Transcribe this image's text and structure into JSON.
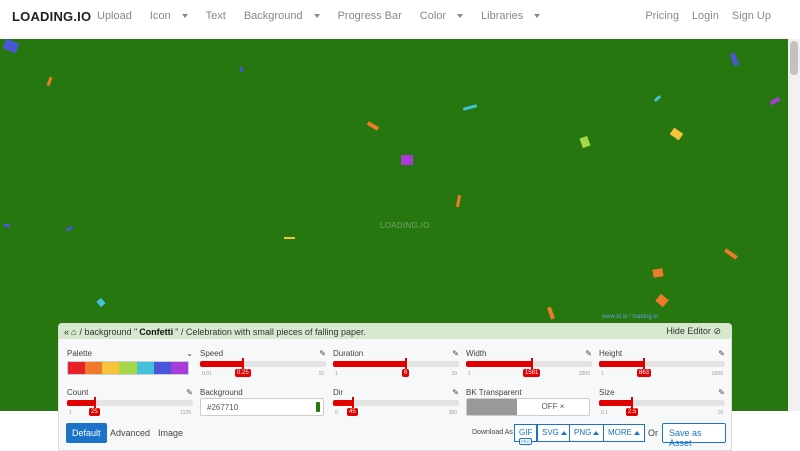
{
  "nav": {
    "brand": "LOADING.IO",
    "left_items": [
      {
        "label": "Upload",
        "dropdown": false
      },
      {
        "label": "Icon",
        "dropdown": true
      },
      {
        "label": "Text",
        "dropdown": false
      },
      {
        "label": "Background",
        "dropdown": true
      },
      {
        "label": "Progress Bar",
        "dropdown": false
      },
      {
        "label": "Color",
        "dropdown": true
      },
      {
        "label": "Libraries",
        "dropdown": true
      }
    ],
    "right_items": [
      "Pricing",
      "Login",
      "Sign Up"
    ]
  },
  "stage": {
    "background_color": "#267710",
    "watermark": "LOADING.IO",
    "credit": "www.ld.io / loading.io"
  },
  "editor": {
    "breadcrumb_home_icon": "home-icon",
    "breadcrumb_prefix": "/ background \"",
    "breadcrumb_name": "Confetti",
    "breadcrumb_suffix": "\" / Celebration with small pieces of falling paper.",
    "hide_label": "Hide Editor",
    "controls": {
      "palette": {
        "label": "Palette",
        "colors": [
          "#e8202a",
          "#f07a2a",
          "#f6c33a",
          "#a6d94a",
          "#44c2d8",
          "#4a56d8",
          "#a93cd8"
        ]
      },
      "speed": {
        "label": "Speed",
        "min": "0.01",
        "max": "10",
        "value": "0.25",
        "fraction": 0.34
      },
      "duration": {
        "label": "Duration",
        "min": "1",
        "max": "10",
        "value": "6",
        "fraction": 0.58
      },
      "width": {
        "label": "Width",
        "min": "1",
        "max": "2000",
        "value": "1581",
        "fraction": 0.52
      },
      "height": {
        "label": "Height",
        "min": "1",
        "max": "2000",
        "value": "863",
        "fraction": 0.36
      },
      "count": {
        "label": "Count",
        "min": "1",
        "max": "1125",
        "value": "25",
        "fraction": 0.22
      },
      "background": {
        "label": "Background",
        "value": "#267710"
      },
      "dir": {
        "label": "Dir",
        "min": "0",
        "max": "360",
        "value": "45",
        "fraction": 0.16
      },
      "bk_transparent": {
        "label": "BK Transparent",
        "value": "OFF ×"
      },
      "size": {
        "label": "Size",
        "min": "0.1",
        "max": "10",
        "value": "2.5",
        "fraction": 0.26
      }
    }
  },
  "footer": {
    "tabs": [
      "Default",
      "Advanced",
      "Image"
    ],
    "download_label": "Download As",
    "formats": [
      "GIF",
      "SVG",
      "PNG",
      "MORE"
    ],
    "pro_badge": "PRO",
    "or_label": "Or",
    "save_label": "Save as Asset"
  },
  "colors": {
    "accent": "#1a73c8",
    "slider": "#e00000",
    "header": "#d6e9cf"
  }
}
